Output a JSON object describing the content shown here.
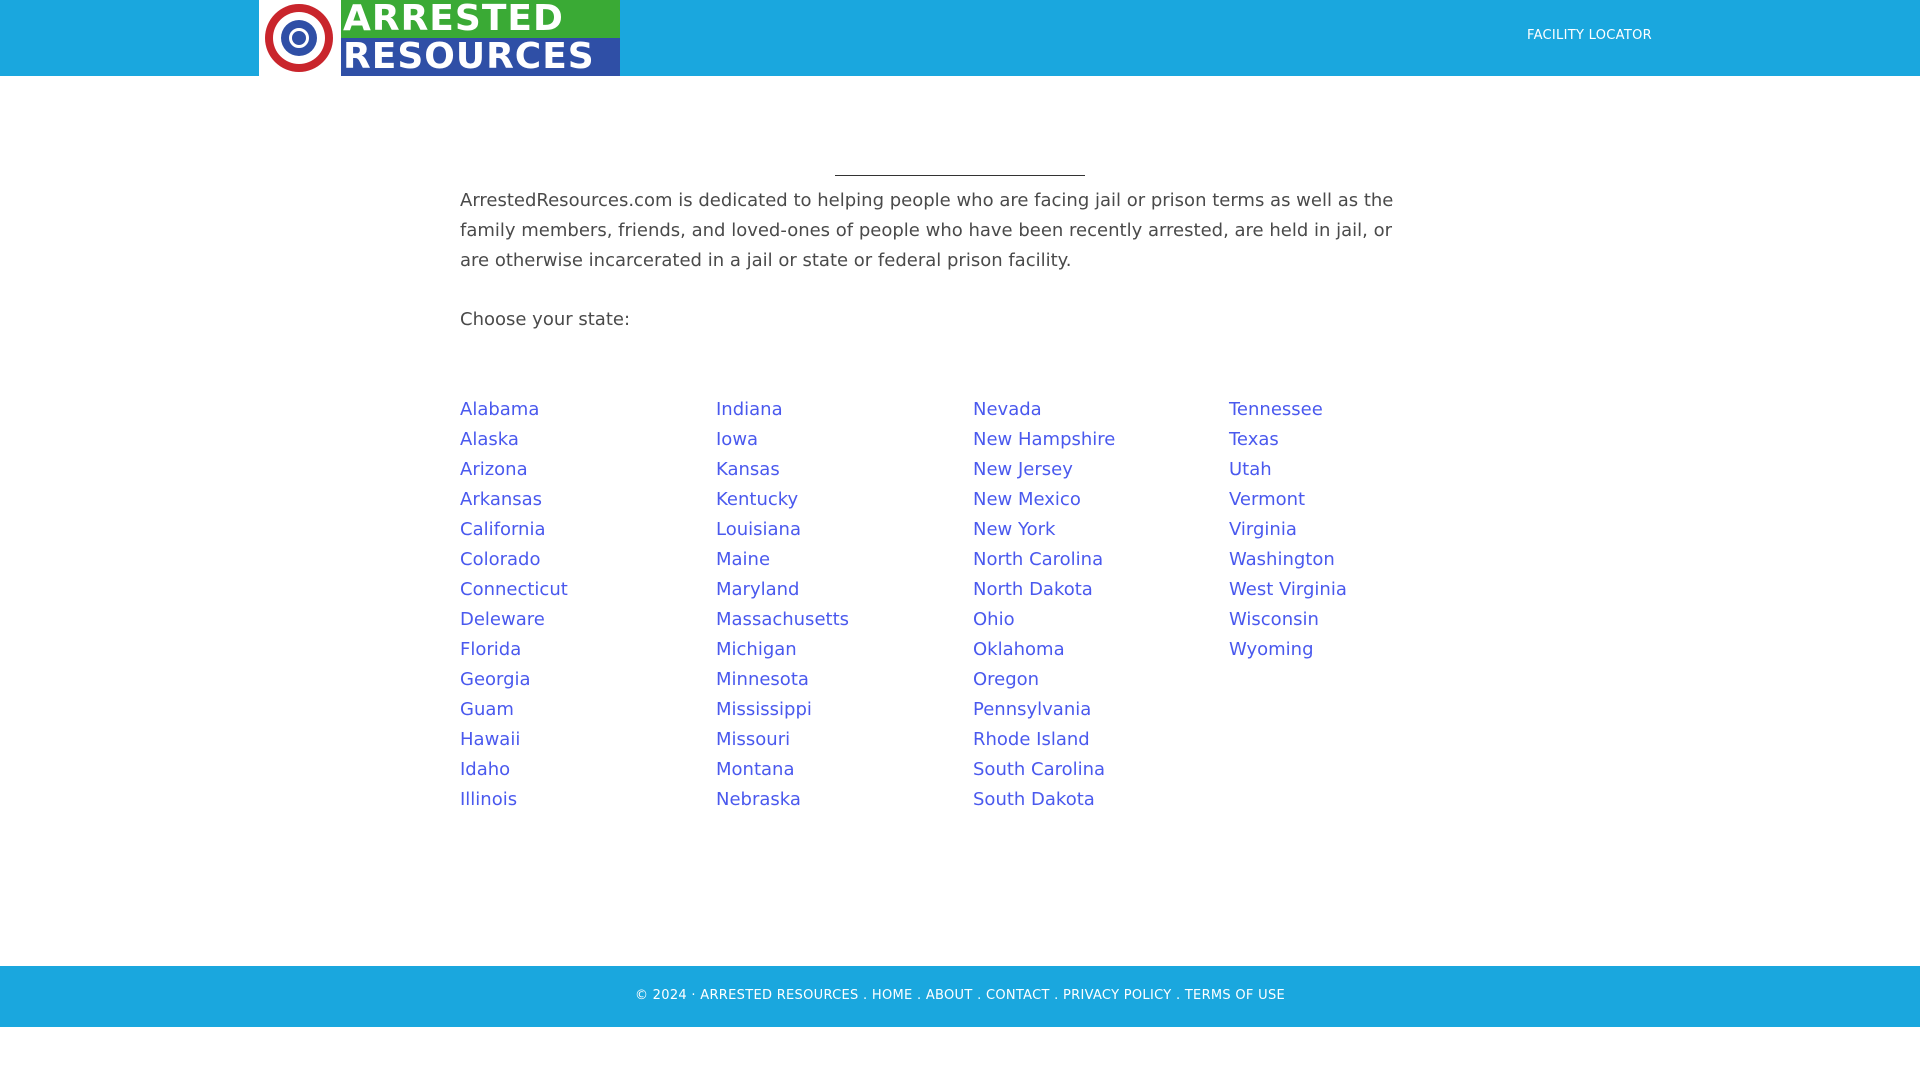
{
  "header": {
    "logo": {
      "line1": "ARRESTED",
      "line2": "RESOURCES",
      "badge_icon": "magnifying-glass-badge-icon"
    },
    "nav": {
      "facility_locator": "FACILITY LOCATOR"
    }
  },
  "main": {
    "intro": "ArrestedResources.com is dedicated to helping people who are facing jail or prison terms as well as the family members, friends, and loved-ones of people who have been recently arrested, are held in jail, or are otherwise incarcerated in a jail or state or federal prison facility.",
    "choose_label": "Choose your state:",
    "states": {
      "col1": [
        "Alabama",
        "Alaska",
        "Arizona",
        "Arkansas",
        "California",
        "Colorado",
        "Connecticut",
        "Deleware",
        "Florida",
        "Georgia",
        "Guam",
        "Hawaii",
        "Idaho",
        "Illinois"
      ],
      "col2": [
        "Indiana",
        "Iowa",
        "Kansas",
        "Kentucky",
        "Louisiana",
        "Maine",
        "Maryland",
        "Massachusetts",
        "Michigan",
        "Minnesota",
        "Mississippi",
        "Missouri",
        "Montana",
        "Nebraska"
      ],
      "col3": [
        "Nevada",
        "New Hampshire",
        "New Jersey",
        "New Mexico",
        "New York",
        "North Carolina",
        "North Dakota",
        "Ohio",
        "Oklahoma",
        "Oregon",
        "Pennsylvania",
        "Rhode Island",
        "South Carolina",
        "South Dakota"
      ],
      "col4": [
        "Tennessee",
        "Texas",
        "Utah",
        "Vermont",
        "Virginia",
        "Washington",
        "West Virginia",
        "Wisconsin",
        "Wyoming"
      ]
    }
  },
  "footer": {
    "copyright": "© 2024 ·",
    "links": {
      "brand": "ARRESTED RESOURCES",
      "home": "HOME",
      "about": "ABOUT",
      "contact": "CONTACT",
      "privacy": "PRIVACY POLICY",
      "terms": "TERMS OF USE"
    },
    "separator": "."
  },
  "colors": {
    "header_bg": "#1aa7de",
    "link": "#4a59ee",
    "body_text": "#4a4a4a",
    "logo_green": "#3aaa35",
    "logo_blue": "#2f4fa6",
    "badge_red": "#c9252c"
  }
}
